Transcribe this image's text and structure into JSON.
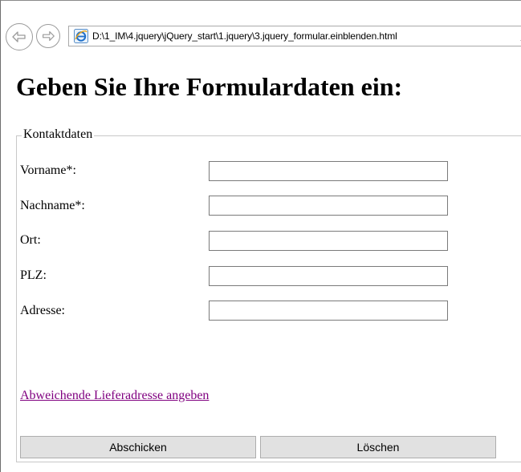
{
  "browser": {
    "url": "D:\\1_IM\\4.jquery\\jQuery_start\\1.jquery\\3.jquery_formular.einblenden.html",
    "icons": {
      "back": "back-arrow-icon",
      "forward": "forward-arrow-icon",
      "page": "internet-explorer-icon",
      "search": "search-icon"
    }
  },
  "page": {
    "title": "Geben Sie Ihre Formulardaten ein:"
  },
  "form": {
    "legend": "Kontaktdaten",
    "fields": [
      {
        "label": "Vorname*:",
        "value": ""
      },
      {
        "label": "Nachname*:",
        "value": ""
      },
      {
        "label": "Ort:",
        "value": ""
      },
      {
        "label": "PLZ:",
        "value": ""
      },
      {
        "label": "Adresse:",
        "value": ""
      }
    ],
    "alt_address_link": "Abweichende Lieferadresse angeben",
    "submit_label": "Abschicken",
    "reset_label": "Löschen"
  },
  "colors": {
    "visited_link": "#800080",
    "button_bg": "#e1e1e1"
  }
}
